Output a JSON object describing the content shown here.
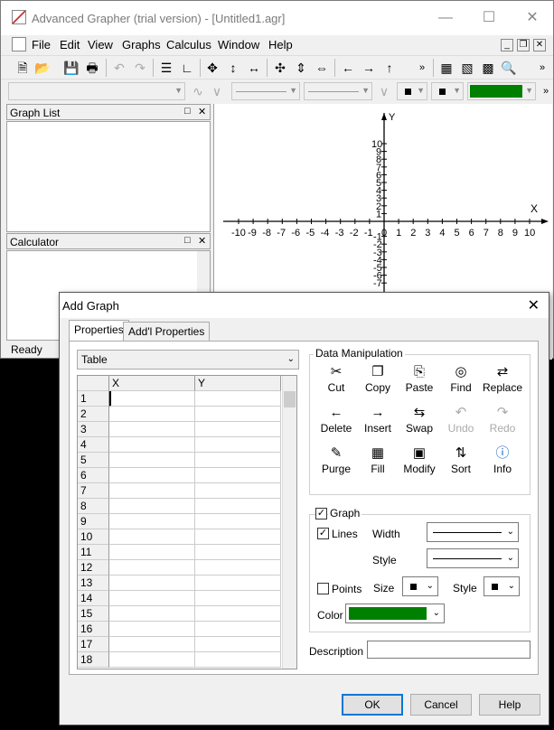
{
  "window": {
    "title": "Advanced Grapher (trial version) - [Untitled1.agr]",
    "colors": {
      "accent": "#0078d7",
      "graph_color": "#008000"
    }
  },
  "menu": [
    {
      "label": "File",
      "key": "F"
    },
    {
      "label": "Edit",
      "key": "E"
    },
    {
      "label": "View",
      "key": "V"
    },
    {
      "label": "Graphs",
      "key": "G"
    },
    {
      "label": "Calculus",
      "key": "C"
    },
    {
      "label": "Window",
      "key": "W"
    },
    {
      "label": "Help",
      "key": "H"
    }
  ],
  "panes": {
    "graph_list": "Graph List",
    "calculator": "Calculator",
    "status": "Ready"
  },
  "axes": {
    "x_label": "X",
    "y_label": "Y",
    "x_ticks": [
      "-10",
      "-9",
      "-8",
      "-7",
      "-6",
      "-5",
      "-4",
      "-3",
      "-2",
      "-1",
      "0",
      "1",
      "2",
      "3",
      "4",
      "5",
      "6",
      "7",
      "8",
      "9",
      "10"
    ],
    "y_ticks_pos": [
      "10",
      "9",
      "8",
      "7",
      "6",
      "5",
      "4",
      "3",
      "2",
      "1"
    ],
    "y_ticks_neg": [
      "-1",
      "-2",
      "-3",
      "-4",
      "-5",
      "-6",
      "-7"
    ]
  },
  "dialog": {
    "title": "Add Graph",
    "tabs": [
      "Properties",
      "Add'l Properties"
    ],
    "type_select": "Table",
    "table": {
      "headers": [
        "X",
        "Y"
      ],
      "rows": [
        "1",
        "2",
        "3",
        "4",
        "5",
        "6",
        "7",
        "8",
        "9",
        "10",
        "11",
        "12",
        "13",
        "14",
        "15",
        "16",
        "17",
        "18"
      ]
    },
    "data_manipulation": {
      "label": "Data Manipulation",
      "buttons": [
        {
          "label": "Cut",
          "icon": "scissors-icon",
          "enabled": true
        },
        {
          "label": "Copy",
          "icon": "copy-icon",
          "enabled": true
        },
        {
          "label": "Paste",
          "icon": "paste-icon",
          "enabled": true
        },
        {
          "label": "Find",
          "icon": "binoculars-icon",
          "enabled": true
        },
        {
          "label": "Replace",
          "icon": "replace-icon",
          "enabled": true
        },
        {
          "label": "Delete",
          "icon": "delete-row-icon",
          "enabled": true
        },
        {
          "label": "Insert",
          "icon": "insert-row-icon",
          "enabled": true
        },
        {
          "label": "Swap",
          "icon": "swap-icon",
          "enabled": true
        },
        {
          "label": "Undo",
          "icon": "undo-icon",
          "enabled": false
        },
        {
          "label": "Redo",
          "icon": "redo-icon",
          "enabled": false
        },
        {
          "label": "Purge",
          "icon": "broom-icon",
          "enabled": true
        },
        {
          "label": "Fill",
          "icon": "fill-icon",
          "enabled": true
        },
        {
          "label": "Modify",
          "icon": "calculator-icon",
          "enabled": true
        },
        {
          "label": "Sort",
          "icon": "sort-icon",
          "enabled": true
        },
        {
          "label": "Info",
          "icon": "info-icon",
          "enabled": true
        }
      ]
    },
    "graph_opts": {
      "graph_label": "Graph",
      "graph_checked": true,
      "lines_label": "Lines",
      "lines_checked": true,
      "width_label": "Width",
      "style_label": "Style",
      "points_label": "Points",
      "points_checked": false,
      "size_label": "Size",
      "pstyle_label": "Style",
      "color_label": "Color"
    },
    "description_label": "Description",
    "description_value": "",
    "buttons": {
      "ok": "OK",
      "cancel": "Cancel",
      "help": "Help"
    }
  }
}
